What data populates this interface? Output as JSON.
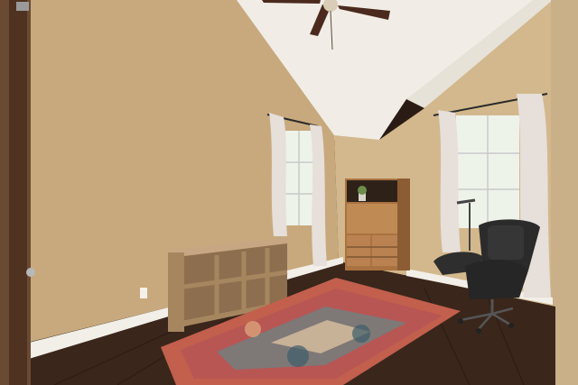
{
  "scene": {
    "description_free": true,
    "colors": {
      "wall_left": "#c7a87c",
      "wall_back": "#d4b98e",
      "wall_right": "#cbb28a",
      "ceiling": "#f1ede6",
      "floor": "#3a261b",
      "baseboard": "#f2efe8",
      "door": "#5a3a24",
      "shelf": "#a9896a",
      "cabinet": "#b07a47",
      "chair": "#2b2b2b",
      "rug_base": "#b9574a",
      "rug_accent": "#5f8b8a",
      "curtain": "#e8e2de",
      "window": "#eef3ea",
      "fan_blade": "#4b2a1d"
    }
  }
}
